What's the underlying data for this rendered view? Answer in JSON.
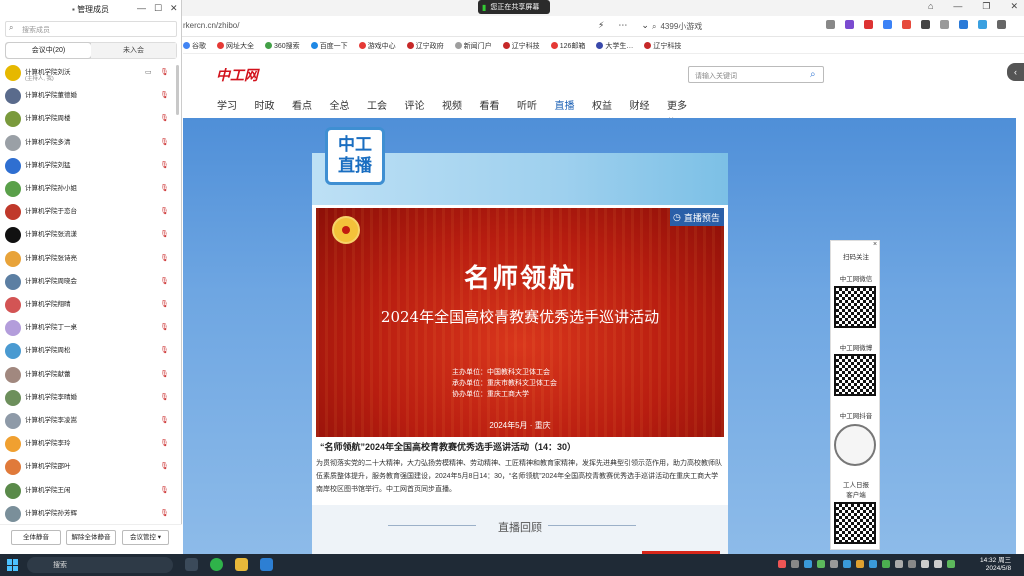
{
  "share_badge": "您正在共享屏幕",
  "browser": {
    "url": "rkercn.cn/zhibo/",
    "search_value": "4399小游戏",
    "bookmarks": [
      "谷歌",
      "网址大全",
      "360搜索",
      "百度一下",
      "游戏中心",
      "辽宁政府",
      "新闻门户",
      "辽宁科技",
      "126邮箱",
      "大学生…",
      "辽宁科技"
    ]
  },
  "site": {
    "logo": "中工网",
    "search_placeholder": "请输入关键词",
    "nav": [
      "学习",
      "时政",
      "看点",
      "全总",
      "工会",
      "评论",
      "视频",
      "看看",
      "听听",
      "直播",
      "权益",
      "财经",
      "更多"
    ],
    "nav_active": "直播",
    "banner_label": "中工直播",
    "banner_line1": "中工",
    "banner_line2": "直播",
    "live_tag": "直播预告",
    "poster_title": "名师领航",
    "poster_subtitle": "2024年全国高校青教赛优秀选手巡讲活动",
    "poster_orgs": [
      "主办单位：中国教科文卫体工会",
      "承办单位：重庆市教科文卫体工会",
      "协办单位：重庆工商大学"
    ],
    "poster_date": "2024年5月 · 重庆",
    "event_title": "“名师领航”2024年全国高校青教赛优秀选手巡讲活动（14：30）",
    "event_desc": "为贯彻落实党的二十大精神，大力弘扬劳模精神、劳动精神、工匠精神和教育家精神，发挥先进典型引领示范作用，助力高校教师队伍素质整体提升，服务教育强国建设，2024年5月8日14：30，“名师领航”2024年全国高校青教赛优秀选手巡讲活动在重庆工商大学南岸校区图书馆举行。中工网首页同步直播。",
    "replay_label": "直播回顾"
  },
  "qr_panel": {
    "title": "扫码关注",
    "items": [
      "中工网微信",
      "中工网微博",
      "中工网抖音",
      "工人日报客户端"
    ],
    "items_lines": [
      "中工网微信",
      "中工网微博",
      "中工网抖音",
      "工人日报",
      "客户端"
    ]
  },
  "panel": {
    "title": "管理成员",
    "search_placeholder": "搜索成员",
    "tab_in_meeting": "会议中(20)",
    "tab_not_joined": "未入会",
    "members": [
      {
        "name": "计算机学院刘沃",
        "sub": "(主持人, 我)",
        "color": "#e6b800"
      },
      {
        "name": "计算机学院董德婚",
        "sub": "",
        "color": "#5a6b8c"
      },
      {
        "name": "计算机学院周楼",
        "sub": "",
        "color": "#7a9a3c"
      },
      {
        "name": "计算机学院多清",
        "sub": "",
        "color": "#9aa0a6"
      },
      {
        "name": "计算机学院刘猛",
        "sub": "",
        "color": "#2f6fd1"
      },
      {
        "name": "计算机学院孙小姐",
        "sub": "",
        "color": "#5aa04a"
      },
      {
        "name": "计算机学院于恋台",
        "sub": "",
        "color": "#c0392b"
      },
      {
        "name": "计算机学院张流漾",
        "sub": "",
        "color": "#111111"
      },
      {
        "name": "计算机学院张诗亮",
        "sub": "",
        "color": "#e8a33a"
      },
      {
        "name": "计算机学院周晓会",
        "sub": "",
        "color": "#5c7fa3"
      },
      {
        "name": "计算机学院翔晴",
        "sub": "",
        "color": "#d35454"
      },
      {
        "name": "计算机学院丁一桌",
        "sub": "",
        "color": "#b39ddb"
      },
      {
        "name": "计算机学院周松",
        "sub": "",
        "color": "#4a9ad1"
      },
      {
        "name": "计算机学院献蕾",
        "sub": "",
        "color": "#a1887f"
      },
      {
        "name": "计算机学院李晴婚",
        "sub": "",
        "color": "#6d8f5c"
      },
      {
        "name": "计算机学院李凌嵩",
        "sub": "",
        "color": "#8e9aa8"
      },
      {
        "name": "计算机学院李玲",
        "sub": "",
        "color": "#f0a030"
      },
      {
        "name": "计算机学院邵叶",
        "sub": "",
        "color": "#e07a3a"
      },
      {
        "name": "计算机学院王闲",
        "sub": "",
        "color": "#5a8a4a"
      },
      {
        "name": "计算机学院孙芳辉",
        "sub": "",
        "color": "#7a8f9a"
      }
    ],
    "btn_mute_all": "全体静音",
    "btn_unmute_all": "解除全体静音",
    "btn_controls": "会议管控 ▾"
  },
  "taskbar": {
    "search_placeholder": "搜索",
    "time": "14:32 周三",
    "date": "2024/5/8"
  },
  "colors": {
    "accent": "#1a5fb4",
    "brand_red": "#d2121c",
    "poster_red": "#b81d10",
    "page_blue": "#4f8fd8"
  }
}
